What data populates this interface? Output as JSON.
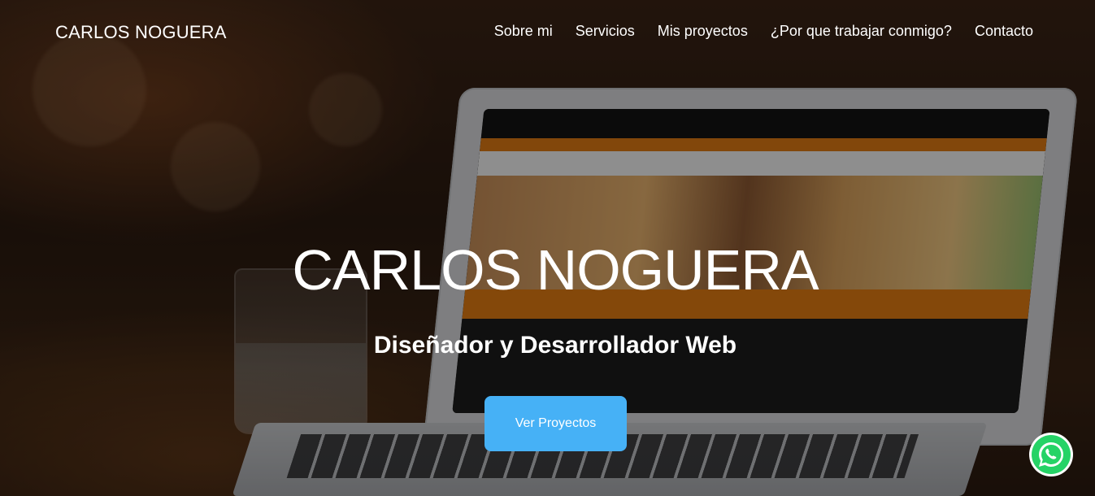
{
  "header": {
    "brand": "CARLOS NOGUERA",
    "nav": [
      {
        "label": "Sobre mi"
      },
      {
        "label": "Servicios"
      },
      {
        "label": "Mis proyectos"
      },
      {
        "label": "¿Por que trabajar conmigo?"
      },
      {
        "label": "Contacto"
      }
    ]
  },
  "hero": {
    "title": "CARLOS NOGUERA",
    "subtitle": "Diseñador y Desarrollador Web",
    "cta_label": "Ver Proyectos"
  },
  "floating": {
    "whatsapp_icon": "whatsapp-icon"
  },
  "colors": {
    "accent": "#46b1f6",
    "whatsapp": "#25D366"
  }
}
